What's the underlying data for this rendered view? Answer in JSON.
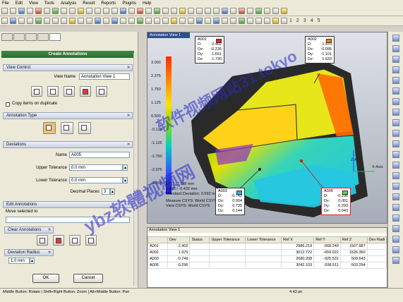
{
  "menu": [
    "File",
    "Edit",
    "View",
    "Tools",
    "Analysis",
    "Result",
    "Reports",
    "Plugins",
    "Help"
  ],
  "toolbar": {
    "numbers": [
      "1",
      "2",
      "3",
      "4",
      "5"
    ]
  },
  "panel": {
    "title": "Create Annotations",
    "view_control": {
      "header": "View Control",
      "view_name_label": "View Name",
      "view_name_value": "Annotation View 1",
      "copy_label": "Copy items on duplicate"
    },
    "annotation_type": {
      "header": "Annotation Type"
    },
    "deviations": {
      "header": "Deviations",
      "name_label": "Name",
      "name_value": "A005",
      "upper_label": "Upper Tolerance",
      "upper_value": "0.0 mm",
      "lower_label": "Lower Tolerance",
      "lower_value": "0.0 mm",
      "places_label": "Decimal Places",
      "places_value": "3"
    },
    "edit": {
      "header": "Edit Annotations",
      "move_label": "Move selected to"
    },
    "clear": {
      "header": "Clear Annotations"
    },
    "radius": {
      "header": "Deviation Radius",
      "value": "1.0 mm"
    },
    "ok": "OK",
    "cancel": "Cancel"
  },
  "viewport": {
    "title": "Annotation View 1",
    "scale": [
      "3.000",
      "2.375",
      "1.750",
      "1.125",
      "0.500",
      "-0.125",
      "-1.125",
      "-1.750",
      "-2.375",
      "-3.000"
    ],
    "stats": {
      "range": "157 / -3.798 mm",
      "mean": "0.493 / -0.432 mm",
      "std": "Standard Deviation: 0.592 mm",
      "measure": "Measure CSYS: World CSYS",
      "view": "View CSYS: World CSYS"
    },
    "axes": {
      "z": "Z-Axis",
      "x": "X-Axis"
    },
    "annotations": [
      {
        "id": "A001",
        "d": "2.402",
        "dx": "-0.226",
        "dy": "-1.651",
        "dz": "1.730",
        "color": "#e3261a"
      },
      {
        "id": "A002",
        "d": "1.970",
        "dx": "-0.095",
        "dy": "-1.101",
        "dz": "1.633",
        "color": "#f07a1a"
      },
      {
        "id": "A003",
        "d": "-0.749",
        "dx": "0.004",
        "dy": "0.735",
        "dz": "0.144",
        "color": "#2ab6e8"
      },
      {
        "id": "A005",
        "d": "-0.296",
        "dx": "0.001",
        "dy": "0.293",
        "dz": "0.043",
        "color": "#56d84a"
      }
    ],
    "labels": {
      "d": "D:",
      "dx": "Dx:",
      "dy": "Dy:",
      "dz": "Dz:"
    }
  },
  "table": {
    "title": "Annotation View 1",
    "headers": [
      "",
      "Dev",
      "Status",
      "Upper Tolerance",
      "Lower Tolerance",
      "Ref X",
      "Ref Y",
      "Ref Z",
      "Dev Radi"
    ],
    "rows": [
      [
        "A001",
        "2.402",
        "",
        "",
        "",
        "2986.219",
        "-668.249",
        "1507.987",
        ""
      ],
      [
        "A002",
        "1.970",
        "",
        "",
        "",
        "3012.722",
        "-659.022",
        "1526.350",
        ""
      ],
      [
        "A003",
        "-0.749",
        "",
        "",
        "",
        "2680.208",
        "-925.531",
        "509.643",
        ""
      ],
      [
        "A005",
        "-0.296",
        "",
        "",
        "",
        "3042.103",
        "-938.511",
        "603.294",
        ""
      ]
    ]
  },
  "status": {
    "left": "Middle Button: Rotate | Shift+Right Button: Zoom | Alt+Middle Button: Pan",
    "time": "4.43 pn"
  },
  "watermark": [
    "软件视频网站31.tokyo",
    "ybz软體视频网"
  ]
}
